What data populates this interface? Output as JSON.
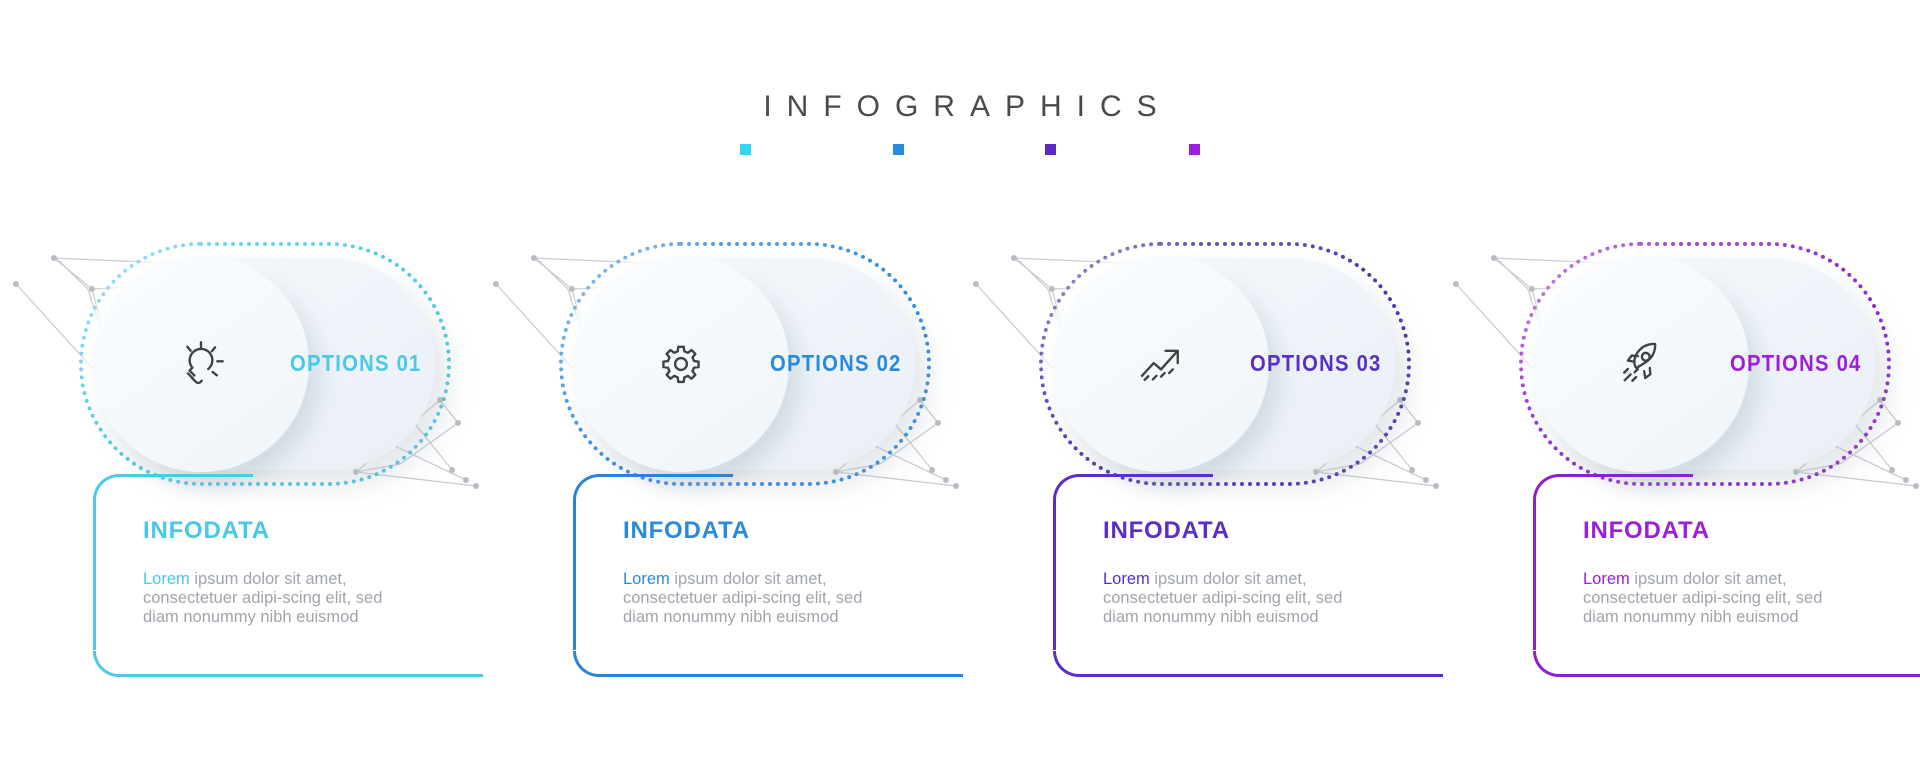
{
  "header": {
    "title": "INFOGRAPHICS",
    "accent_dots": [
      "#32d7ef",
      "#2a8ade",
      "#5a2bc4",
      "#9b20d9"
    ]
  },
  "cards": [
    {
      "option_label": "OPTIONS 01",
      "icon": "lightbulb-icon",
      "heading": "INFODATA",
      "body_lead": "Lorem",
      "body_rest": " ipsum dolor sit amet, consectetuer adipi-scing elit, sed diam nonummy nibh euismod",
      "color": "#49c8e8",
      "dot_color": "#49c8e8",
      "frame_color": "#4cc9e6"
    },
    {
      "option_label": "OPTIONS 02",
      "icon": "gear-icon",
      "heading": "INFODATA",
      "body_lead": "Lorem",
      "body_rest": " ipsum dolor sit amet, consectetuer adipi-scing elit, sed diam nonummy nibh euismod",
      "color": "#2a8ade",
      "dot_color": "#2a8ade",
      "frame_color": "#2a83d6"
    },
    {
      "option_label": "OPTIONS 03",
      "icon": "trending-up-icon",
      "heading": "INFODATA",
      "body_lead": "Lorem",
      "body_rest": " ipsum dolor sit amet, consectetuer adipi-scing elit, sed diam nonummy nibh euismod",
      "color": "#5b2ec6",
      "dot_color": "#4b2aa8",
      "frame_color": "#5b2ec6"
    },
    {
      "option_label": "OPTIONS 04",
      "icon": "rocket-icon",
      "heading": "INFODATA",
      "body_lead": "Lorem",
      "body_rest": " ipsum dolor sit amet, consectetuer adipi-scing elit, sed diam nonummy nibh euismod",
      "color": "#9b20d9",
      "dot_color": "#8e1ec7",
      "frame_color": "#8f1fc9"
    }
  ]
}
